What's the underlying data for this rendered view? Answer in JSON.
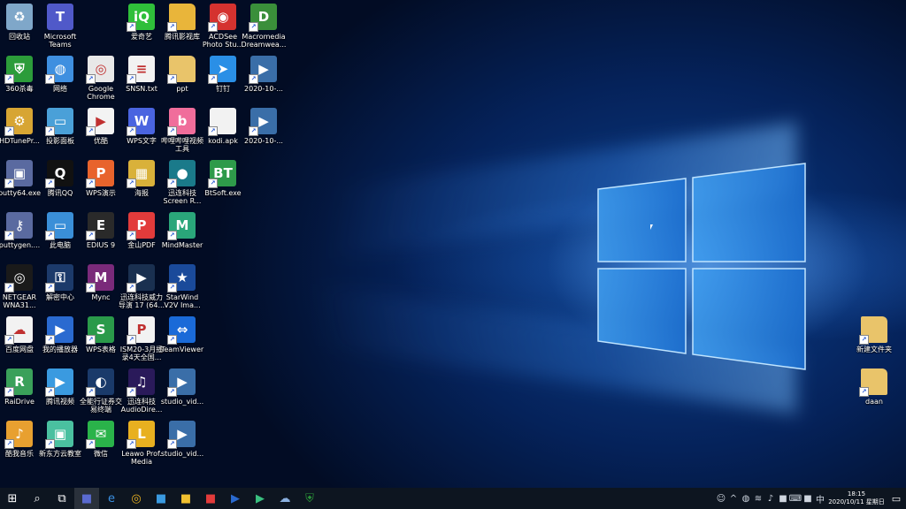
{
  "desktop": {
    "icons": [
      {
        "label": "回收站",
        "icon": "recycle-bin-icon",
        "color": "#7fa7c9"
      },
      {
        "label": "Microsoft\nTeams",
        "icon": "teams-icon",
        "color": "#5059c9"
      },
      {
        "label": "爱奇艺",
        "icon": "iqiyi-icon",
        "color": "#2fbf3a"
      },
      {
        "label": "腾讯影视库",
        "icon": "folder-icon",
        "color": "#e9b53a"
      },
      {
        "label": "ACDSee\nPhoto Stu...",
        "icon": "acdsee-icon",
        "color": "#d5322f"
      },
      {
        "label": "Macromedia\nDreamwea...",
        "icon": "dreamweaver-icon",
        "color": "#3a8f3a"
      },
      {
        "label": "360杀毒",
        "icon": "shield-icon",
        "color": "#2c9c3a"
      },
      {
        "label": "网络",
        "icon": "network-icon",
        "color": "#3f8fe0"
      },
      {
        "label": "Google\nChrome",
        "icon": "chrome-icon",
        "color": "#e8e8e8"
      },
      {
        "label": "SNSN.txt",
        "icon": "text-file-icon",
        "color": "#f2f2f2"
      },
      {
        "label": "ppt",
        "icon": "folder-icon",
        "color": "#e9c46a"
      },
      {
        "label": "钉钉",
        "icon": "dingtalk-icon",
        "color": "#2a8fe6"
      },
      {
        "label": "2020-10-...",
        "icon": "video-file-icon",
        "color": "#3a6ea8"
      },
      {
        "label": "HDTunePr...",
        "icon": "hdtune-icon",
        "color": "#d7a533"
      },
      {
        "label": "投影面板",
        "icon": "projector-icon",
        "color": "#4aa0d8"
      },
      {
        "label": "优酷",
        "icon": "youku-icon",
        "color": "#f3f3f3"
      },
      {
        "label": "WPS文字",
        "icon": "wps-writer-icon",
        "color": "#4a64e0"
      },
      {
        "label": "哔哩哔哩视频\n工具",
        "icon": "bilibili-icon",
        "color": "#f06d9b"
      },
      {
        "label": "kodi.apk",
        "icon": "blank-file-icon",
        "color": "#f2f2f2"
      },
      {
        "label": "2020-10-...",
        "icon": "video-file-icon",
        "color": "#3a6ea8"
      },
      {
        "label": "putty64.exe",
        "icon": "putty-icon",
        "color": "#5a6aa0"
      },
      {
        "label": "腾讯QQ",
        "icon": "qq-icon",
        "color": "#111111"
      },
      {
        "label": "WPS演示",
        "icon": "wps-presentation-icon",
        "color": "#e8632c"
      },
      {
        "label": "海报",
        "icon": "archive-icon",
        "color": "#d9b13a"
      },
      {
        "label": "迅连科技\nScreen R...",
        "icon": "screen-recorder-icon",
        "color": "#1a7a8a"
      },
      {
        "label": "BtSoft.exe",
        "icon": "bt-icon",
        "color": "#2e9a4a"
      },
      {
        "label": "puttygen....",
        "icon": "puttygen-icon",
        "color": "#5a6aa0"
      },
      {
        "label": "此电脑",
        "icon": "computer-icon",
        "color": "#3a8fd8"
      },
      {
        "label": "EDIUS 9",
        "icon": "edius-icon",
        "color": "#2a2a2a"
      },
      {
        "label": "金山PDF",
        "icon": "pdf-icon",
        "color": "#e23b3b"
      },
      {
        "label": "MindMaster",
        "icon": "mindmaster-icon",
        "color": "#2aa67a"
      },
      {
        "label": "NETGEAR\nWNA31...",
        "icon": "netgear-icon",
        "color": "#1a1a1a"
      },
      {
        "label": "解密中心",
        "icon": "decrypt-icon",
        "color": "#1c3a6a"
      },
      {
        "label": "Mync",
        "icon": "mync-icon",
        "color": "#7a2a7a"
      },
      {
        "label": "迅连科技威力\n导演 17 (64...",
        "icon": "powerdirector-icon",
        "color": "#1a3050"
      },
      {
        "label": "StarWind\nV2V Ima...",
        "icon": "starwind-icon",
        "color": "#1a4a9a"
      },
      {
        "label": "百度网盘",
        "icon": "baidu-netdisk-icon",
        "color": "#f2f2f2"
      },
      {
        "label": "我的播放器",
        "icon": "player-icon",
        "color": "#2a6ad0"
      },
      {
        "label": "WPS表格",
        "icon": "wps-spreadsheet-icon",
        "color": "#2a9a4a"
      },
      {
        "label": "ISM20-3月播\n录4天全国...",
        "icon": "pdf-file-icon",
        "color": "#f2f2f2"
      },
      {
        "label": "TeamViewer",
        "icon": "teamviewer-icon",
        "color": "#1a6ad8"
      },
      {
        "label": "RaiDrive",
        "icon": "raidrive-icon",
        "color": "#3aa05a"
      },
      {
        "label": "腾讯视频",
        "icon": "tencent-video-icon",
        "color": "#3a9ae0"
      },
      {
        "label": "全能行证券交\n易终端",
        "icon": "securities-icon",
        "color": "#1a3a6a"
      },
      {
        "label": "迅连科技\nAudioDire...",
        "icon": "audiodirector-icon",
        "color": "#2a1a5a"
      },
      {
        "label": "studio_vid...",
        "icon": "video-file-icon",
        "color": "#3a6ea8"
      },
      {
        "label": "酷我音乐",
        "icon": "kuwo-icon",
        "color": "#e8a030"
      },
      {
        "label": "新东方云教室",
        "icon": "classroom-icon",
        "color": "#4ac0a0"
      },
      {
        "label": "微信",
        "icon": "wechat-icon",
        "color": "#2ab34a"
      },
      {
        "label": "Leawo Prof.\nMedia",
        "icon": "leawo-icon",
        "color": "#e8b020"
      },
      {
        "label": "studio_vid...",
        "icon": "video-file-icon",
        "color": "#3a6ea8"
      },
      {
        "label": "新建文件夹",
        "icon": "folder-icon",
        "color": "#e9c46a"
      },
      {
        "label": "daan",
        "icon": "folder-icon",
        "color": "#e9c46a"
      }
    ]
  },
  "taskbar": {
    "items": [
      {
        "icon": "start-windows-icon",
        "color": "#ffffff"
      },
      {
        "icon": "search-icon",
        "color": "#ffffff"
      },
      {
        "icon": "task-view-icon",
        "color": "#ffffff"
      },
      {
        "icon": "taskbar-app-icon",
        "color": "#5a6ad0"
      },
      {
        "icon": "edge-icon",
        "color": "#3a8fe0"
      },
      {
        "icon": "chrome-icon",
        "color": "#e8b020"
      },
      {
        "icon": "taskbar-app-icon",
        "color": "#3a9ae0"
      },
      {
        "icon": "taskbar-app-icon",
        "color": "#f0c030"
      },
      {
        "icon": "taskbar-app-icon",
        "color": "#e23b3b"
      },
      {
        "icon": "player-icon",
        "color": "#2a6ad0"
      },
      {
        "icon": "tencent-video-icon",
        "color": "#3ac080"
      },
      {
        "icon": "baidu-netdisk-icon",
        "color": "#8ab0e0"
      },
      {
        "icon": "shield-icon",
        "color": "#2c9c3a"
      }
    ],
    "tray_icons": [
      "person-icon",
      "chevron-up-icon",
      "network-icon",
      "wifi-icon",
      "volume-icon",
      "tray-app-icon",
      "keyboard-icon",
      "tray-app-icon",
      "ime-icon"
    ],
    "time": "18:15",
    "date": "2020/10/11 星期日"
  }
}
